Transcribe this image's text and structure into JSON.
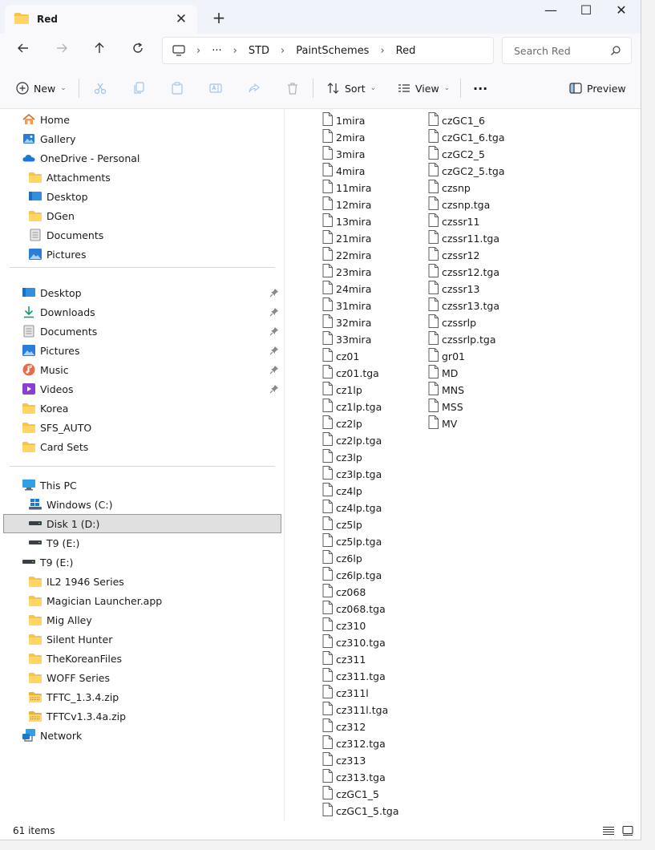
{
  "tab": {
    "title": "Red",
    "close": "✕",
    "new": "+"
  },
  "window_controls": {
    "minimize": "—",
    "maximize": "☐",
    "close": "✕"
  },
  "address": {
    "more": "···",
    "crumbs": [
      "STD",
      "PaintSchemes",
      "Red"
    ],
    "separator": "›"
  },
  "search": {
    "placeholder": "Search Red"
  },
  "commands": {
    "new": "New",
    "sort": "Sort",
    "view": "View",
    "more": "···",
    "preview": "Preview",
    "caret": "⌄"
  },
  "sidebar": {
    "home": "Home",
    "gallery": "Gallery",
    "onedrive": "OneDrive - Personal",
    "onedrive_children": [
      "Attachments",
      "Desktop",
      "DGen",
      "Documents",
      "Pictures"
    ],
    "quick": [
      "Desktop",
      "Downloads",
      "Documents",
      "Pictures",
      "Music",
      "Videos",
      "Korea",
      "SFS_AUTO",
      "Card Sets"
    ],
    "this_pc": "This PC",
    "drives": [
      "Windows (C:)",
      "Disk 1 (D:)",
      "T9 (E:)"
    ],
    "t9": "T9 (E:)",
    "t9_children": [
      "IL2 1946 Series",
      "Magician Launcher.app",
      "Mig Alley",
      "Silent Hunter",
      "TheKoreanFiles",
      "WOFF Series",
      "TFTC_1.3.4.zip",
      "TFTCv1.3.4a.zip"
    ],
    "network": "Network"
  },
  "files": [
    "1mira",
    "2mira",
    "3mira",
    "4mira",
    "11mira",
    "12mira",
    "13mira",
    "21mira",
    "22mira",
    "23mira",
    "24mira",
    "31mira",
    "32mira",
    "33mira",
    "cz01",
    "cz01.tga",
    "cz1lp",
    "cz1lp.tga",
    "cz2lp",
    "cz2lp.tga",
    "cz3lp",
    "cz3lp.tga",
    "cz4lp",
    "cz4lp.tga",
    "cz5lp",
    "cz5lp.tga",
    "cz6lp",
    "cz6lp.tga",
    "cz068",
    "cz068.tga",
    "cz310",
    "cz310.tga",
    "cz311",
    "cz311.tga",
    "cz311l",
    "cz311l.tga",
    "cz312",
    "cz312.tga",
    "cz313",
    "cz313.tga",
    "czGC1_5",
    "czGC1_5.tga",
    "czGC1_6",
    "czGC1_6.tga",
    "czGC2_5",
    "czGC2_5.tga",
    "czsnp",
    "czsnp.tga",
    "czssr11",
    "czssr11.tga",
    "czssr12",
    "czssr12.tga",
    "czssr13",
    "czssr13.tga",
    "czssrlp",
    "czssrlp.tga",
    "gr01",
    "MD",
    "MNS",
    "MSS",
    "MV"
  ],
  "status": {
    "count": "61 items"
  },
  "colors": {
    "folder": "#f7c34a",
    "accent": "#0067c0",
    "selected_bg": "#e0e0e0"
  }
}
